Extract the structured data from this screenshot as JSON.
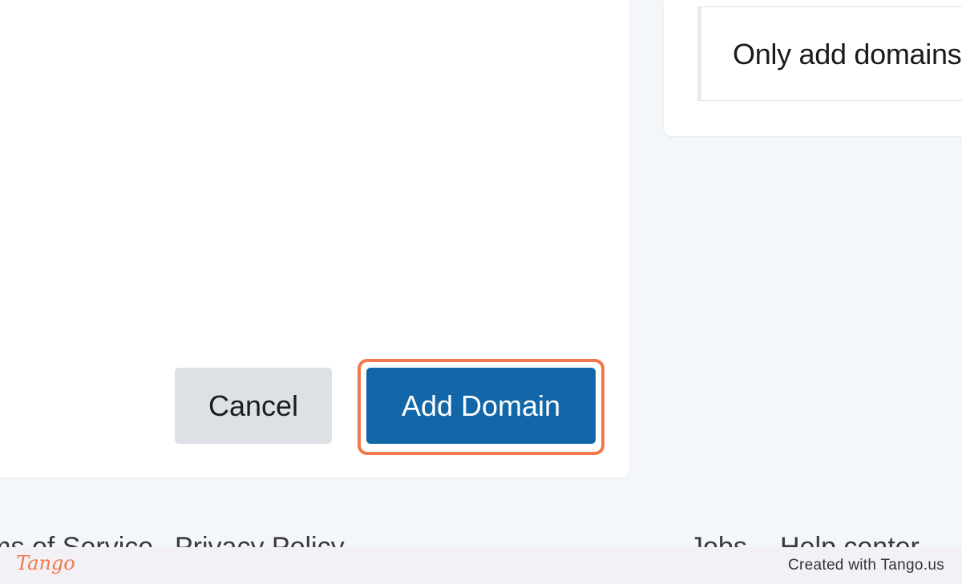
{
  "notice": {
    "text": "Only add domains"
  },
  "dialog_actions": {
    "cancel_label": "Cancel",
    "add_domain_label": "Add Domain"
  },
  "footer": {
    "links": [
      "Terms of Service",
      "Privacy Policy",
      "Jobs",
      "Help center"
    ]
  },
  "tango_bar": {
    "logo": "Tango",
    "credit": "Created with Tango.us"
  },
  "colors": {
    "primary_button": "#1167a7",
    "highlight": "#f0784a",
    "page_background": "#f4f7fa"
  }
}
